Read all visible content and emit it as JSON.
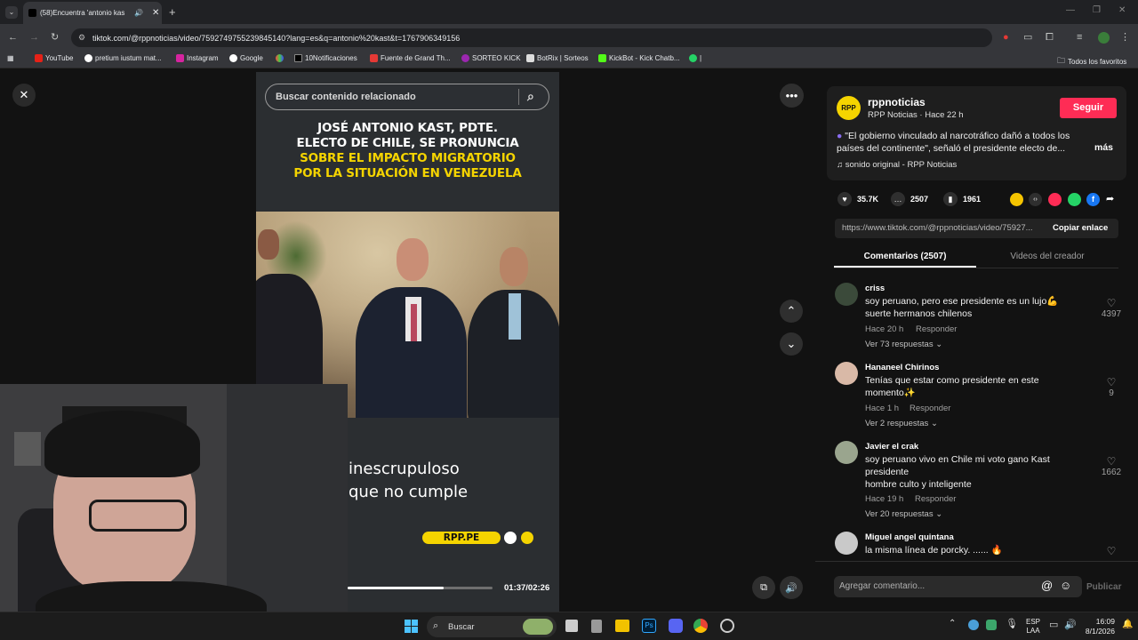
{
  "browser": {
    "tab_title": "(58)Encuentra 'antonio kas",
    "url": "tiktok.com/@rppnoticias/video/7592749755239845140?lang=es&q=antonio%20kast&t=1767906349156",
    "bookmarks": [
      "YouTube",
      "pretium iustum mat...",
      "Instagram",
      "Google",
      "10Notificaciones",
      "Fuente de Grand Th...",
      "SORTEO KICK",
      "BotRix | Sorteos",
      "KickBot - Kick Chatb...",
      "|"
    ],
    "all_bookmarks": "Todos los favoritos"
  },
  "video": {
    "search_placeholder": "Buscar contenido relacionado",
    "headline_white": "JOSÉ ANTONIO KAST, PDTE.\nELECTO DE CHILE, SE PRONUNCIA",
    "headline_yellow": "SOBRE EL IMPACTO MIGRATORIO\nPOR LA SITUACIÓN EN VENEZUELA",
    "subtitle_1": "inescrupuloso",
    "subtitle_2": "que no cumple",
    "brand": "RPP.PE",
    "time": "01:37/02:26",
    "progress": 0.66
  },
  "creator": {
    "name": "rppnoticias",
    "sub": "RPP Noticias · Hace 22 h",
    "follow": "Seguir",
    "caption": "\"El gobierno vinculado al narcotráfico dañó a todos los países del continente\", señaló el presidente electo de...",
    "more": "más",
    "sound": "sonido original - RPP Noticias"
  },
  "stats": {
    "likes": "35.7K",
    "comments": "2507",
    "saves": "1961"
  },
  "share_link": "https://www.tiktok.com/@rppnoticias/video/75927...",
  "copy_link": "Copiar enlace",
  "tabs": [
    "Comentarios (2507)",
    "Videos del creador"
  ],
  "comments": [
    {
      "user": "criss",
      "text": "soy peruano, pero ese presidente es un lujo💪\nsuerte hermanos chilenos",
      "time": "Hace 20 h",
      "reply": "Responder",
      "replies": "Ver 73 respuestas",
      "likes": "4397"
    },
    {
      "user": "Hananeel Chirinos",
      "text": "Tenías que estar como presidente en este\nmomento✨",
      "time": "Hace 1 h",
      "reply": "Responder",
      "replies": "Ver 2 respuestas",
      "likes": "9"
    },
    {
      "user": "Javier el crak",
      "text": "soy peruano vivo en Chile mi voto gano Kast\npresidente\nhombre culto y inteligente",
      "time": "Hace 19 h",
      "reply": "Responder",
      "replies": "Ver 20 respuestas",
      "likes": "1662"
    },
    {
      "user": "Miguel angel quintana",
      "text": "la misma línea de porcky. ...... 🔥",
      "time": "",
      "reply": "",
      "replies": "",
      "likes": ""
    }
  ],
  "comment_input": {
    "placeholder": "Agregar comentario...",
    "publish": "Publicar"
  },
  "taskbar": {
    "search": "Buscar",
    "lang": "ESP",
    "lang2": "LAA",
    "time": "16:09",
    "date": "8/1/2026"
  },
  "colors": {
    "accent": "#fe2c55",
    "brand_yellow": "#f5d400"
  }
}
